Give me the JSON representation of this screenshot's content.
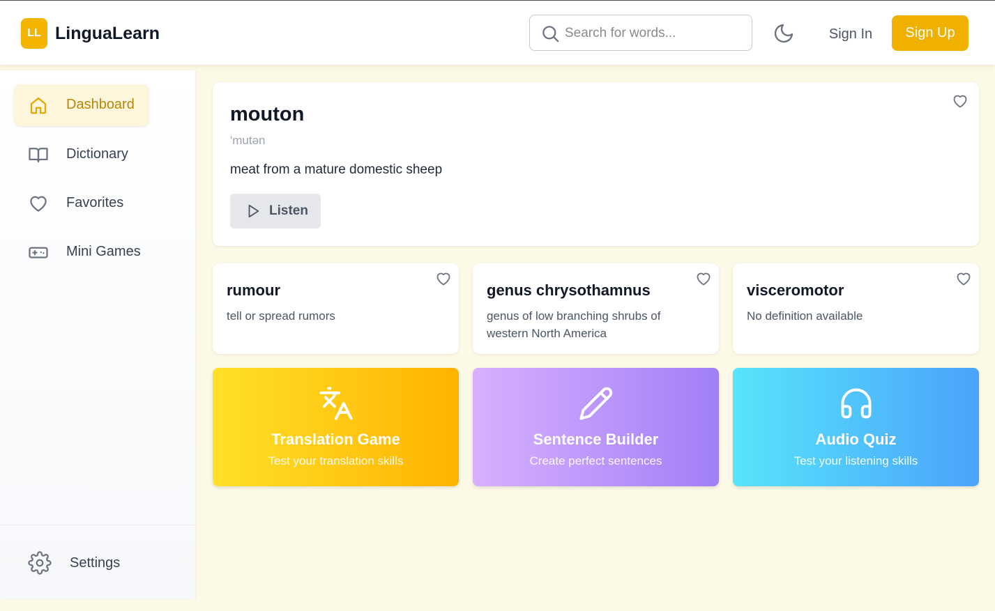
{
  "app": {
    "logo_initials": "LL",
    "name": "LinguaLearn"
  },
  "header": {
    "search_placeholder": "Search for words...",
    "sign_in": "Sign In",
    "sign_up": "Sign Up"
  },
  "sidebar": {
    "items": [
      {
        "label": "Dashboard",
        "icon": "home-icon",
        "active": true
      },
      {
        "label": "Dictionary",
        "icon": "book-icon",
        "active": false
      },
      {
        "label": "Favorites",
        "icon": "heart-icon",
        "active": false
      },
      {
        "label": "Mini Games",
        "icon": "gamepad-icon",
        "active": false
      }
    ],
    "settings_label": "Settings"
  },
  "featured_word": {
    "word": "mouton",
    "phonetic": "'mutən",
    "definition": "meat from a mature domestic sheep",
    "listen_label": "Listen"
  },
  "word_cards": [
    {
      "word": "rumour",
      "definition": "tell or spread rumors"
    },
    {
      "word": "genus chrysothamnus",
      "definition": "genus of low branching shrubs of western North America"
    },
    {
      "word": "visceromotor",
      "definition": "No definition available"
    }
  ],
  "games": [
    {
      "title": "Translation Game",
      "subtitle": "Test your translation skills",
      "icon": "translate-icon"
    },
    {
      "title": "Sentence Builder",
      "subtitle": "Create perfect sentences",
      "icon": "pencil-icon"
    },
    {
      "title": "Audio Quiz",
      "subtitle": "Test your listening skills",
      "icon": "headphones-icon"
    }
  ],
  "colors": {
    "accent": "#efb000",
    "page_bg": "#fdf9e7",
    "translation_gradient": [
      "#ffe02a",
      "#ffb300"
    ],
    "sentence_gradient": [
      "#d8b0ff",
      "#a17ff7"
    ],
    "audio_gradient": [
      "#57e4fb",
      "#4aa3fb"
    ]
  }
}
